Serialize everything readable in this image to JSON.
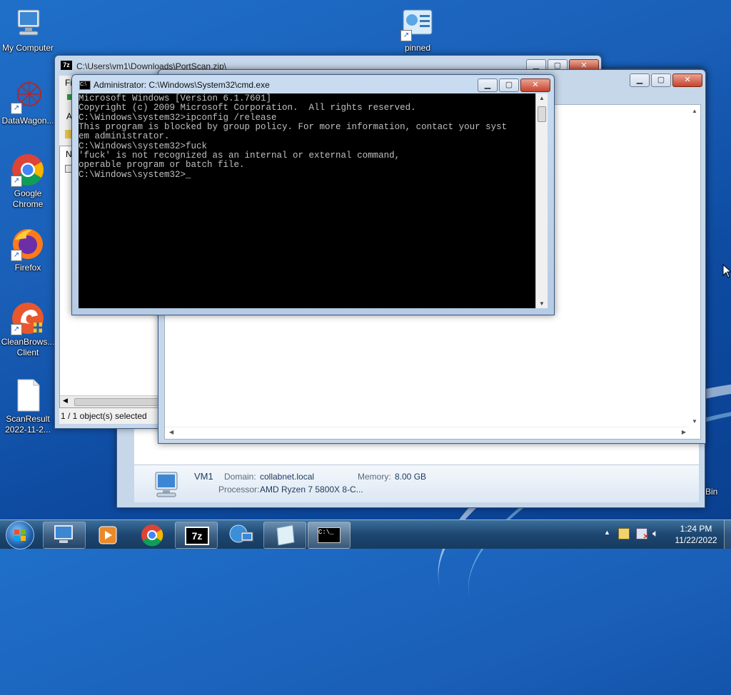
{
  "desktop": {
    "icons": [
      {
        "label": "My Computer"
      },
      {
        "label": "DataWagon..."
      },
      {
        "label": "Google Chrome"
      },
      {
        "label": "Firefox"
      },
      {
        "label": "CleanBrows... Client"
      },
      {
        "label": "ScanResult 2022-11-2..."
      },
      {
        "label": "pinned"
      },
      {
        "label": "Bin"
      }
    ]
  },
  "zip_window": {
    "title": "C:\\Users\\vm1\\Downloads\\PortScan.zip\\",
    "menu_first": "Fi",
    "side_letter": "A",
    "col_header": "N",
    "status": "1 / 1 object(s) selected"
  },
  "system_info": {
    "name": "VM1",
    "domain_label": "Domain:",
    "domain_value": "collabnet.local",
    "memory_label": "Memory:",
    "memory_value": "8.00 GB",
    "processor_label": "Processor:",
    "processor_value": "AMD Ryzen 7 5800X 8-C..."
  },
  "cmd": {
    "title": "Administrator: C:\\Windows\\System32\\cmd.exe",
    "lines": [
      "Microsoft Windows [Version 6.1.7601]",
      "Copyright (c) 2009 Microsoft Corporation.  All rights reserved.",
      "",
      "C:\\Windows\\system32>ipconfig /release",
      "This program is blocked by group policy. For more information, contact your syst",
      "em administrator.",
      "",
      "C:\\Windows\\system32>fuck",
      "'fuck' is not recognized as an internal or external command,",
      "operable program or batch file.",
      "",
      "C:\\Windows\\system32>_"
    ]
  },
  "taskbar": {
    "clock_time": "1:24 PM",
    "clock_date": "11/22/2022",
    "items": [
      "computer",
      "media-player",
      "chrome",
      "7-zip",
      "network",
      "notepad",
      "cmd"
    ]
  },
  "colors": {
    "console_bg": "#000000",
    "console_text": "#c0c0c0",
    "desktop": "#1a5fb8"
  }
}
